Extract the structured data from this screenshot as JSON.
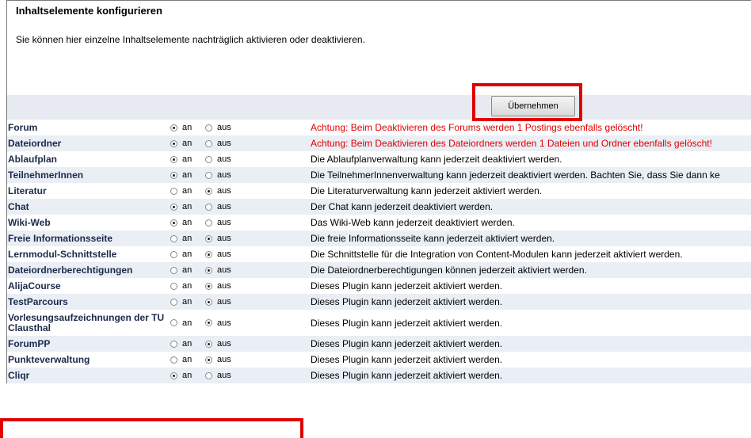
{
  "header": {
    "title": "Inhaltselemente konfigurieren",
    "description": "Sie können hier einzelne Inhaltselemente nachträglich aktivieren oder deaktivieren."
  },
  "apply_button": "Übernehmen",
  "labels": {
    "on": "an",
    "off": "aus"
  },
  "highlight_color": "#e00000",
  "rows": [
    {
      "name": "Forum",
      "state": "an",
      "warn": true,
      "message": "Achtung: Beim Deaktivieren des Forums werden 1 Postings ebenfalls gelöscht!"
    },
    {
      "name": "Dateiordner",
      "state": "an",
      "warn": true,
      "message": "Achtung: Beim Deaktivieren des Dateiordners werden 1 Dateien und Ordner ebenfalls gelöscht!"
    },
    {
      "name": "Ablaufplan",
      "state": "an",
      "warn": false,
      "message": "Die Ablaufplanverwaltung kann jederzeit deaktiviert werden."
    },
    {
      "name": "TeilnehmerInnen",
      "state": "an",
      "warn": false,
      "message": "Die TeilnehmerInnenverwaltung kann jederzeit deaktiviert werden. Bachten Sie, dass Sie dann ke"
    },
    {
      "name": "Literatur",
      "state": "aus",
      "warn": false,
      "message": "Die Literaturverwaltung kann jederzeit aktiviert werden."
    },
    {
      "name": "Chat",
      "state": "an",
      "warn": false,
      "message": "Der Chat kann jederzeit deaktiviert werden."
    },
    {
      "name": "Wiki-Web",
      "state": "an",
      "warn": false,
      "message": "Das Wiki-Web kann jederzeit deaktiviert werden."
    },
    {
      "name": "Freie Informationsseite",
      "state": "aus",
      "warn": false,
      "message": "Die freie Informationsseite kann jederzeit aktiviert werden."
    },
    {
      "name": "Lernmodul-Schnittstelle",
      "state": "aus",
      "warn": false,
      "message": "Die Schnittstelle für die Integration von Content-Modulen kann jederzeit aktiviert werden."
    },
    {
      "name": "Dateiordnerberechtigungen",
      "state": "aus",
      "warn": false,
      "message": "Die Dateiordnerberechtigungen können jederzeit aktiviert werden."
    },
    {
      "name": "AlijaCourse",
      "state": "aus",
      "warn": false,
      "message": "Dieses Plugin kann jederzeit aktiviert werden."
    },
    {
      "name": "TestParcours",
      "state": "aus",
      "warn": false,
      "message": "Dieses Plugin kann jederzeit aktiviert werden."
    },
    {
      "name": "Vorlesungsaufzeichnungen der TU Clausthal",
      "state": "aus",
      "warn": false,
      "tall": true,
      "message": "Dieses Plugin kann jederzeit aktiviert werden."
    },
    {
      "name": "ForumPP",
      "state": "aus",
      "warn": false,
      "message": "Dieses Plugin kann jederzeit aktiviert werden."
    },
    {
      "name": "Punkteverwaltung",
      "state": "aus",
      "warn": false,
      "message": "Dieses Plugin kann jederzeit aktiviert werden."
    },
    {
      "name": "Cliqr",
      "state": "an",
      "warn": false,
      "message": "Dieses Plugin kann jederzeit aktiviert werden."
    }
  ]
}
